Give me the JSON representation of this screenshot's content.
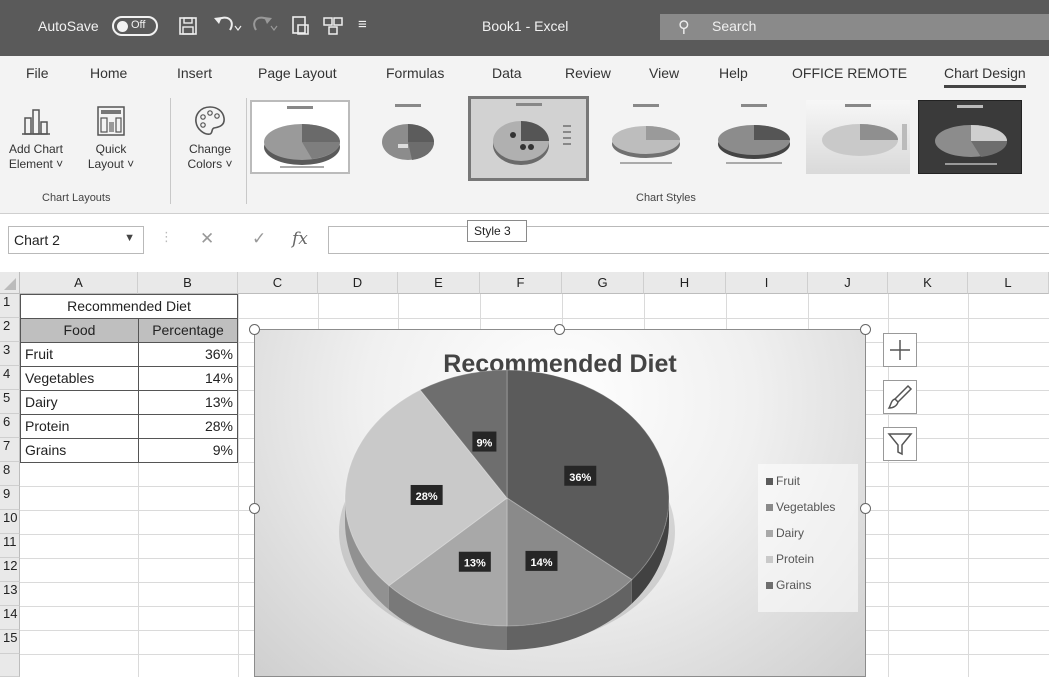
{
  "titlebar": {
    "autosave_label": "AutoSave",
    "autosave_state": "Off",
    "document_title": "Book1 - Excel",
    "search_placeholder": "Search"
  },
  "tabs": [
    "File",
    "Home",
    "Insert",
    "Page Layout",
    "Formulas",
    "Data",
    "Review",
    "View",
    "Help",
    "OFFICE REMOTE",
    "Chart Design"
  ],
  "active_tab": "Chart Design",
  "ribbon": {
    "add_chart_element": [
      "Add Chart",
      "Element ˅"
    ],
    "quick_layout": [
      "Quick",
      "Layout ˅"
    ],
    "change_colors": [
      "Change",
      "Colors ˅"
    ],
    "group_chart_layouts": "Chart Layouts",
    "group_chart_styles": "Chart Styles",
    "hovered_style_tooltip": "Style 3"
  },
  "formula_bar": {
    "name_box": "Chart 2",
    "cancel_symbol": "✕",
    "enter_symbol": "✓",
    "fx_symbol": "fx",
    "formula": ""
  },
  "columns": [
    "A",
    "B",
    "C",
    "D",
    "E",
    "F",
    "G",
    "H",
    "I",
    "J",
    "K",
    "L"
  ],
  "rows": [
    "1",
    "2",
    "3",
    "4",
    "5",
    "6",
    "7",
    "8",
    "9",
    "10",
    "11",
    "12",
    "13",
    "14",
    "15"
  ],
  "sheet": {
    "table_title": "Recommended Diet",
    "header_food": "Food",
    "header_percentage": "Percentage",
    "data": [
      {
        "food": "Fruit",
        "pct": "36%"
      },
      {
        "food": "Vegetables",
        "pct": "14%"
      },
      {
        "food": "Dairy",
        "pct": "13%"
      },
      {
        "food": "Protein",
        "pct": "28%"
      },
      {
        "food": "Grains",
        "pct": "9%"
      }
    ]
  },
  "chart_data": {
    "type": "pie",
    "title": "Recommended Diet",
    "categories": [
      "Fruit",
      "Vegetables",
      "Dairy",
      "Protein",
      "Grains"
    ],
    "values": [
      36,
      14,
      13,
      28,
      9
    ],
    "data_labels": [
      "36%",
      "14%",
      "13%",
      "28%",
      "9%"
    ],
    "legend_position": "right",
    "style": "3-D pie, Style 3",
    "colors": [
      "#5b5b5b",
      "#8a8a8a",
      "#a8a8a8",
      "#c9c9c9",
      "#6e6e6e"
    ]
  },
  "chart_tools": [
    "plus-icon",
    "brush-icon",
    "filter-icon"
  ]
}
